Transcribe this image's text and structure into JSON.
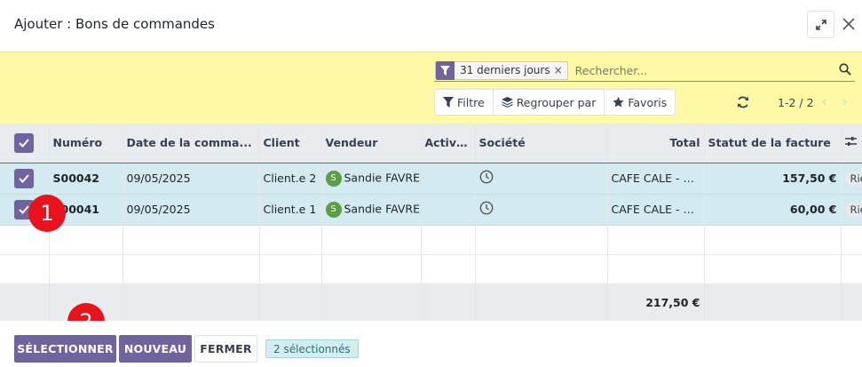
{
  "modal": {
    "title": "Ajouter : Bons de commandes"
  },
  "search": {
    "facet_label": "31 derniers jours",
    "facet_remove": "×",
    "placeholder": "Rechercher..."
  },
  "toolbar": {
    "filter_label": "Filtre",
    "group_label": "Regrouper par",
    "favorites_label": "Favoris"
  },
  "pager": {
    "value": "1-2 / 2",
    "prev": "‹",
    "next": "›"
  },
  "table": {
    "columns": [
      "Numéro",
      "Date de la comma...",
      "Client",
      "Vendeur",
      "Activités",
      "Société",
      "Total",
      "Statut de la facture"
    ],
    "rows": [
      {
        "numero": "S00042",
        "date": "09/05/2025",
        "client": "Client.e 2",
        "vendeur_initial": "S",
        "vendeur": "Sandie FAVRE",
        "societe": "CAFE CALE - BONSAI ...",
        "total": "157,50 €",
        "statut": "Rien à facturer"
      },
      {
        "numero": "S00041",
        "date": "09/05/2025",
        "client": "Client.e 1",
        "vendeur_initial": "S",
        "vendeur": "Sandie FAVRE",
        "societe": "CAFE CALE - BONSAI ...",
        "total": "60,00 €",
        "statut": "Rien à facturer"
      }
    ],
    "footer_total": "217,50 €"
  },
  "footer": {
    "select_label": "SÉLECTIONNER",
    "new_label": "NOUVEAU",
    "close_label": "FERMER",
    "selected_count": "2 sélectionnés"
  },
  "markers": {
    "first": "1",
    "second": "2"
  },
  "colors": {
    "accent": "#71639e",
    "control_panel": "#fdf9a6",
    "selected_row": "#d3ebf0",
    "marker": "#e8131c"
  }
}
